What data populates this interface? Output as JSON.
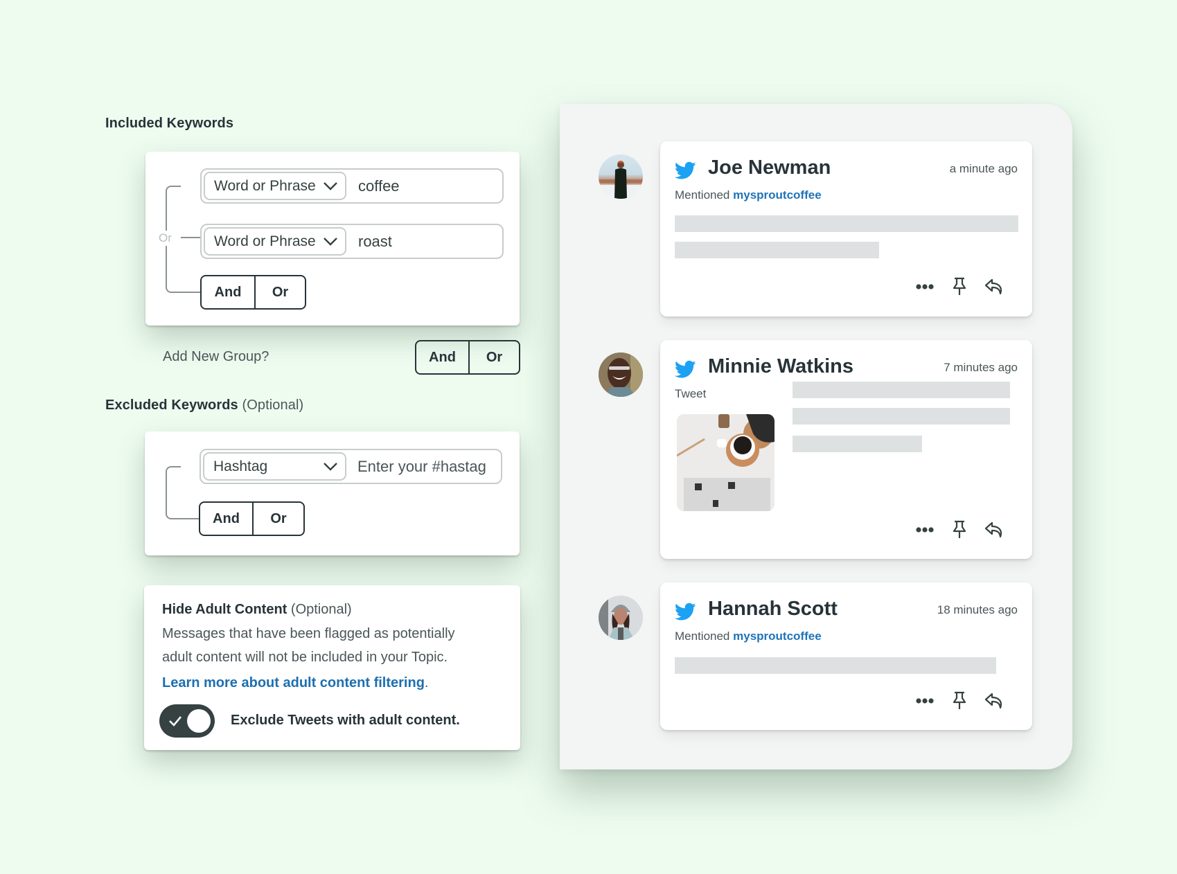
{
  "included": {
    "title": "Included Keywords",
    "group_operator_label": "Or",
    "rows": [
      {
        "type": "Word or Phrase",
        "value": "coffee"
      },
      {
        "type": "Word or Phrase",
        "value": "roast"
      }
    ],
    "and_label": "And",
    "or_label": "Or"
  },
  "add_group": {
    "label": "Add New Group?",
    "and_label": "And",
    "or_label": "Or"
  },
  "excluded": {
    "title": "Excluded Keywords",
    "optional": "(Optional)",
    "rows": [
      {
        "type": "Hashtag",
        "value": "",
        "placeholder": "Enter your #hastag"
      }
    ],
    "and_label": "And",
    "or_label": "Or"
  },
  "adult": {
    "title": "Hide Adult Content",
    "optional": "(Optional)",
    "body_line1": "Messages that have been flagged as potentially",
    "body_line2": "adult content will not be included in your Topic.",
    "link": "Learn more about adult content filtering",
    "link_suffix": ".",
    "toggle_on": true,
    "toggle_label": "Exclude Tweets with adult content."
  },
  "feed": {
    "items": [
      {
        "network_icon": "twitter-bird-icon",
        "name": "Joe Newman",
        "time": "a minute ago",
        "subtitle_prefix": "Mentioned",
        "subtitle_link": "mysproutcoffee",
        "has_image": false
      },
      {
        "network_icon": "twitter-bird-icon",
        "name": "Minnie Watkins",
        "time": "7 minutes ago",
        "subtitle_prefix": "Tweet",
        "subtitle_link": "",
        "has_image": true
      },
      {
        "network_icon": "twitter-bird-icon",
        "name": "Hannah Scott",
        "time": "18 minutes ago",
        "subtitle_prefix": "Mentioned",
        "subtitle_link": "mysproutcoffee",
        "has_image": false
      }
    ],
    "actions": [
      "more-icon",
      "pin-icon",
      "reply-icon"
    ]
  },
  "colors": {
    "background": "#eefcf0",
    "text_dark": "#273338",
    "text_muted": "#4a5557",
    "link": "#1d6fb0",
    "twitter": "#1da1f2",
    "toggle": "#364141",
    "skeleton": "#dee1e1",
    "panel": "#f3f4f4"
  }
}
